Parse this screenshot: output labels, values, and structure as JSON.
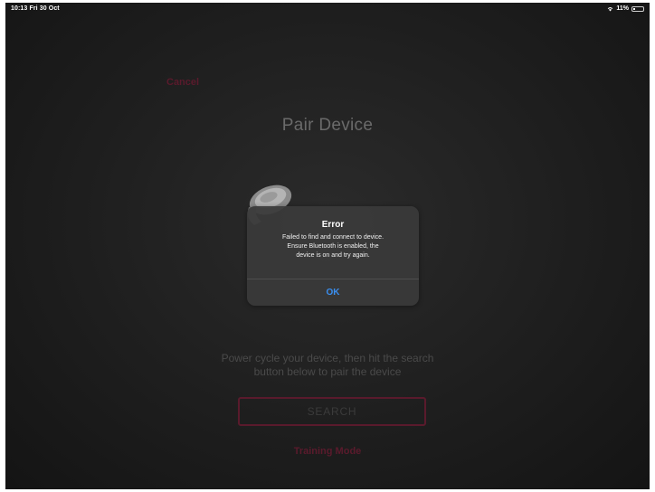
{
  "status_bar": {
    "time_date": "10:13  Fri 30 Oct",
    "battery": "11%",
    "wifi_icon": "wifi-icon",
    "battery_icon": "battery-icon"
  },
  "nav": {
    "cancel_label": "Cancel"
  },
  "page": {
    "title": "Pair Device",
    "device_image": "device-image",
    "instructions_line1": "Power cycle your device, then hit the search",
    "instructions_line2": "button below to pair the device",
    "search_label": "SEARCH",
    "training_mode_label": "Training Mode"
  },
  "alert": {
    "title": "Error",
    "message_line1": "Failed to find and connect to device.",
    "message_line2": "Ensure Bluetooth is enabled, the",
    "message_line3": "device is on and try again.",
    "ok_label": "OK"
  },
  "colors": {
    "accent": "#5a1a2c",
    "alert_button": "#3a8ff0",
    "background": "#1e1e1e"
  }
}
